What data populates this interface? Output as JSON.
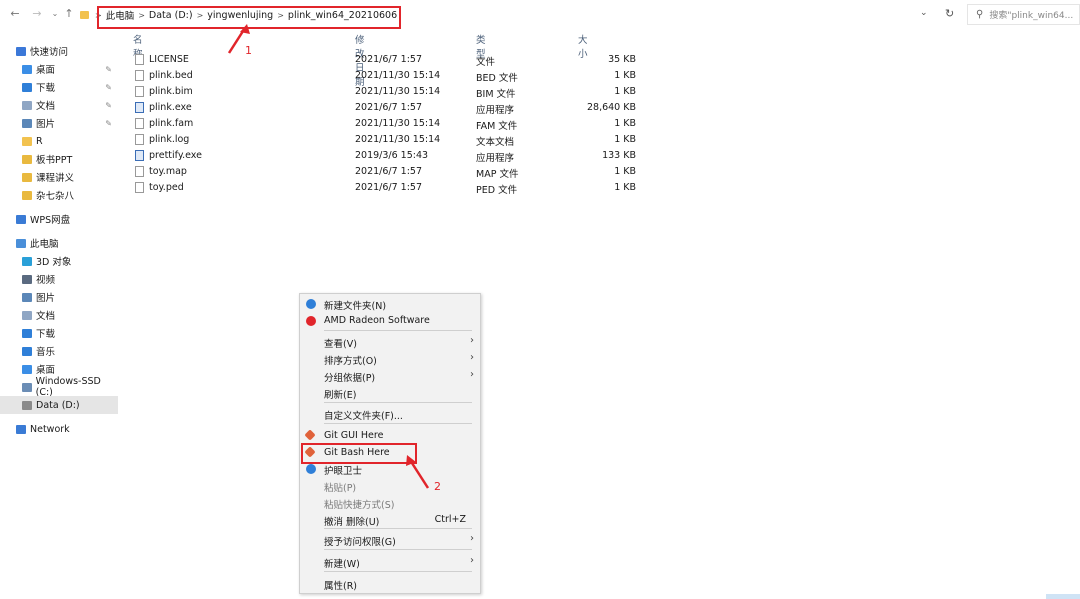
{
  "address": {
    "crumbs": [
      "此电脑",
      "Data (D:)",
      "yingwenlujing",
      "plink_win64_20210606"
    ],
    "search_placeholder": "搜索\"plink_win64..."
  },
  "sidebar": {
    "items": [
      {
        "label": "快速访问",
        "icon": "star-icon",
        "color": "#3b78d8"
      },
      {
        "label": "桌面",
        "icon": "desktop-icon",
        "color": "#3b8ee6",
        "pinned": true
      },
      {
        "label": "下载",
        "icon": "download-icon",
        "color": "#2f7fd8",
        "pinned": true
      },
      {
        "label": "文档",
        "icon": "document-icon",
        "color": "#8fa6c4",
        "pinned": true
      },
      {
        "label": "图片",
        "icon": "picture-icon",
        "color": "#5b87b8",
        "pinned": true
      },
      {
        "label": "R",
        "icon": "folder-icon",
        "color": "#f2c24f"
      },
      {
        "label": "板书PPT",
        "icon": "folder-green-icon",
        "color": "#e9b93f"
      },
      {
        "label": "课程讲义",
        "icon": "folder-green-icon",
        "color": "#e9b93f"
      },
      {
        "label": "杂七杂八",
        "icon": "folder-green-icon",
        "color": "#e9b93f"
      },
      {
        "label": "WPS网盘",
        "icon": "cloud-icon",
        "color": "#3a7bd5"
      },
      {
        "label": "此电脑",
        "icon": "computer-icon",
        "color": "#4a8fd9"
      },
      {
        "label": "3D 对象",
        "icon": "cube-icon",
        "color": "#2aa0d8"
      },
      {
        "label": "视频",
        "icon": "video-icon",
        "color": "#5a6a80"
      },
      {
        "label": "图片",
        "icon": "picture-icon",
        "color": "#5b87b8"
      },
      {
        "label": "文档",
        "icon": "document-icon",
        "color": "#8fa6c4"
      },
      {
        "label": "下载",
        "icon": "download-icon",
        "color": "#2f7fd8"
      },
      {
        "label": "音乐",
        "icon": "music-icon",
        "color": "#2f7fd8"
      },
      {
        "label": "桌面",
        "icon": "desktop-icon",
        "color": "#3b8ee6"
      },
      {
        "label": "Windows-SSD (C:)",
        "icon": "drive-icon",
        "color": "#6b8db5"
      },
      {
        "label": "Data (D:)",
        "icon": "drive-icon",
        "color": "#8a8a8a",
        "selected": true
      },
      {
        "label": "Network",
        "icon": "network-icon",
        "color": "#3a7bd5"
      }
    ]
  },
  "files": {
    "columns": [
      "名称",
      "修改日期",
      "类型",
      "大小"
    ],
    "rows": [
      {
        "name": "LICENSE",
        "date": "2021/6/7 1:57",
        "type": "文件",
        "size": "35 KB",
        "exe": false
      },
      {
        "name": "plink.bed",
        "date": "2021/11/30 15:14",
        "type": "BED 文件",
        "size": "1 KB",
        "exe": false
      },
      {
        "name": "plink.bim",
        "date": "2021/11/30 15:14",
        "type": "BIM 文件",
        "size": "1 KB",
        "exe": false
      },
      {
        "name": "plink.exe",
        "date": "2021/6/7 1:57",
        "type": "应用程序",
        "size": "28,640 KB",
        "exe": true
      },
      {
        "name": "plink.fam",
        "date": "2021/11/30 15:14",
        "type": "FAM 文件",
        "size": "1 KB",
        "exe": false
      },
      {
        "name": "plink.log",
        "date": "2021/11/30 15:14",
        "type": "文本文档",
        "size": "1 KB",
        "exe": false
      },
      {
        "name": "prettify.exe",
        "date": "2019/3/6 15:43",
        "type": "应用程序",
        "size": "133 KB",
        "exe": true
      },
      {
        "name": "toy.map",
        "date": "2021/6/7 1:57",
        "type": "MAP 文件",
        "size": "1 KB",
        "exe": false
      },
      {
        "name": "toy.ped",
        "date": "2021/6/7 1:57",
        "type": "PED 文件",
        "size": "1 KB",
        "exe": false
      }
    ]
  },
  "context_menu": {
    "items": [
      {
        "label": "新建文件夹(N)",
        "icon": "new-folder-icon",
        "color": "#2f7fd8"
      },
      {
        "label": "AMD Radeon Software",
        "icon": "amd-radeon-icon",
        "color": "#e1252b"
      },
      {
        "label": "查看(V)",
        "submenu": true
      },
      {
        "label": "排序方式(O)",
        "submenu": true
      },
      {
        "label": "分组依据(P)",
        "submenu": true
      },
      {
        "label": "刷新(E)"
      },
      {
        "label": "自定义文件夹(F)..."
      },
      {
        "label": "Git GUI Here",
        "icon": "git-icon",
        "color": "#e0623a"
      },
      {
        "label": "Git Bash Here",
        "icon": "git-icon",
        "color": "#e0623a"
      },
      {
        "label": "护眼卫士",
        "icon": "eye-guard-icon",
        "color": "#2f7fd8"
      },
      {
        "label": "粘贴(P)",
        "disabled": true
      },
      {
        "label": "粘贴快捷方式(S)",
        "disabled": true
      },
      {
        "label": "撤消 删除(U)",
        "shortcut": "Ctrl+Z"
      },
      {
        "label": "授予访问权限(G)",
        "submenu": true
      },
      {
        "label": "新建(W)",
        "submenu": true
      },
      {
        "label": "属性(R)"
      }
    ]
  },
  "annotations": {
    "label1": "1",
    "label2": "2",
    "color": "#e1252b"
  }
}
